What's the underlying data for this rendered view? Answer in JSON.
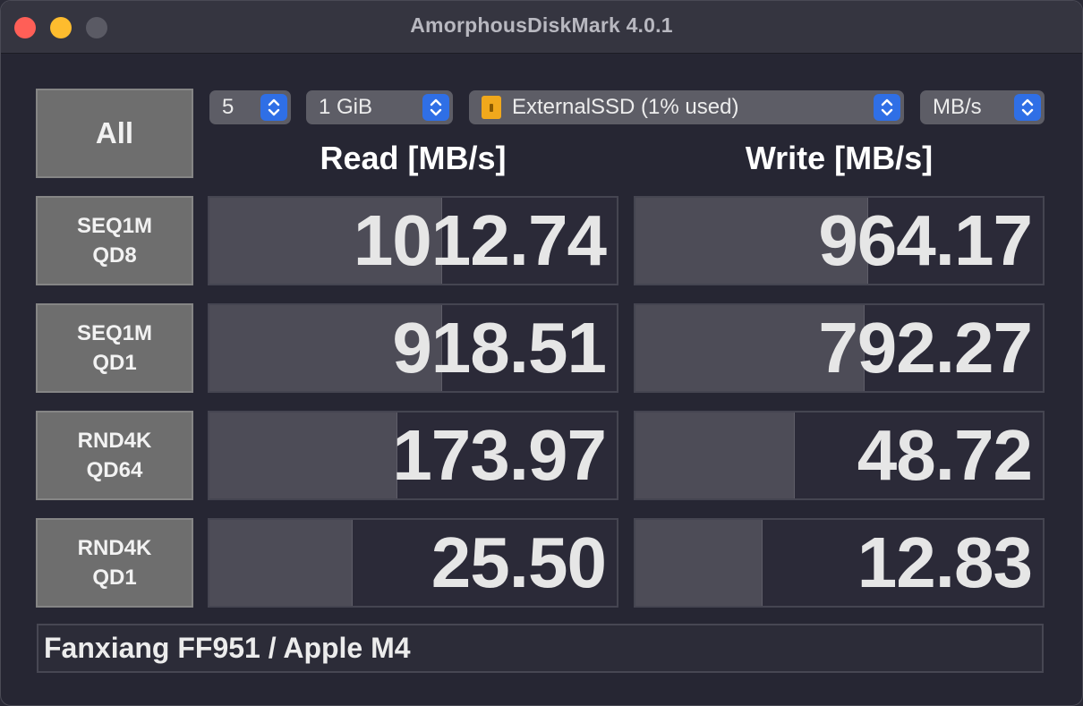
{
  "window": {
    "title": "AmorphousDiskMark 4.0.1"
  },
  "controls": {
    "all_label": "All",
    "count": "5",
    "size": "1 GiB",
    "disk": "ExternalSSD (1% used)",
    "unit": "MB/s"
  },
  "headers": {
    "read": "Read [MB/s]",
    "write": "Write [MB/s]"
  },
  "rows": [
    {
      "line1": "SEQ1M",
      "line2": "QD8",
      "read": "1012.74",
      "read_pct": 57,
      "write": "964.17",
      "write_pct": 57
    },
    {
      "line1": "SEQ1M",
      "line2": "QD1",
      "read": "918.51",
      "read_pct": 57,
      "write": "792.27",
      "write_pct": 56
    },
    {
      "line1": "RND4K",
      "line2": "QD64",
      "read": "173.97",
      "read_pct": 46,
      "write": "48.72",
      "write_pct": 39
    },
    {
      "line1": "RND4K",
      "line2": "QD1",
      "read": "25.50",
      "read_pct": 35,
      "write": "12.83",
      "write_pct": 31
    }
  ],
  "footer": {
    "text": "Fanxiang FF951 / Apple M4"
  },
  "colors": {
    "close": "#ff5f57",
    "minimize": "#febc2e",
    "stepper": "#2f6fe6",
    "bar": "#4d4c57"
  }
}
